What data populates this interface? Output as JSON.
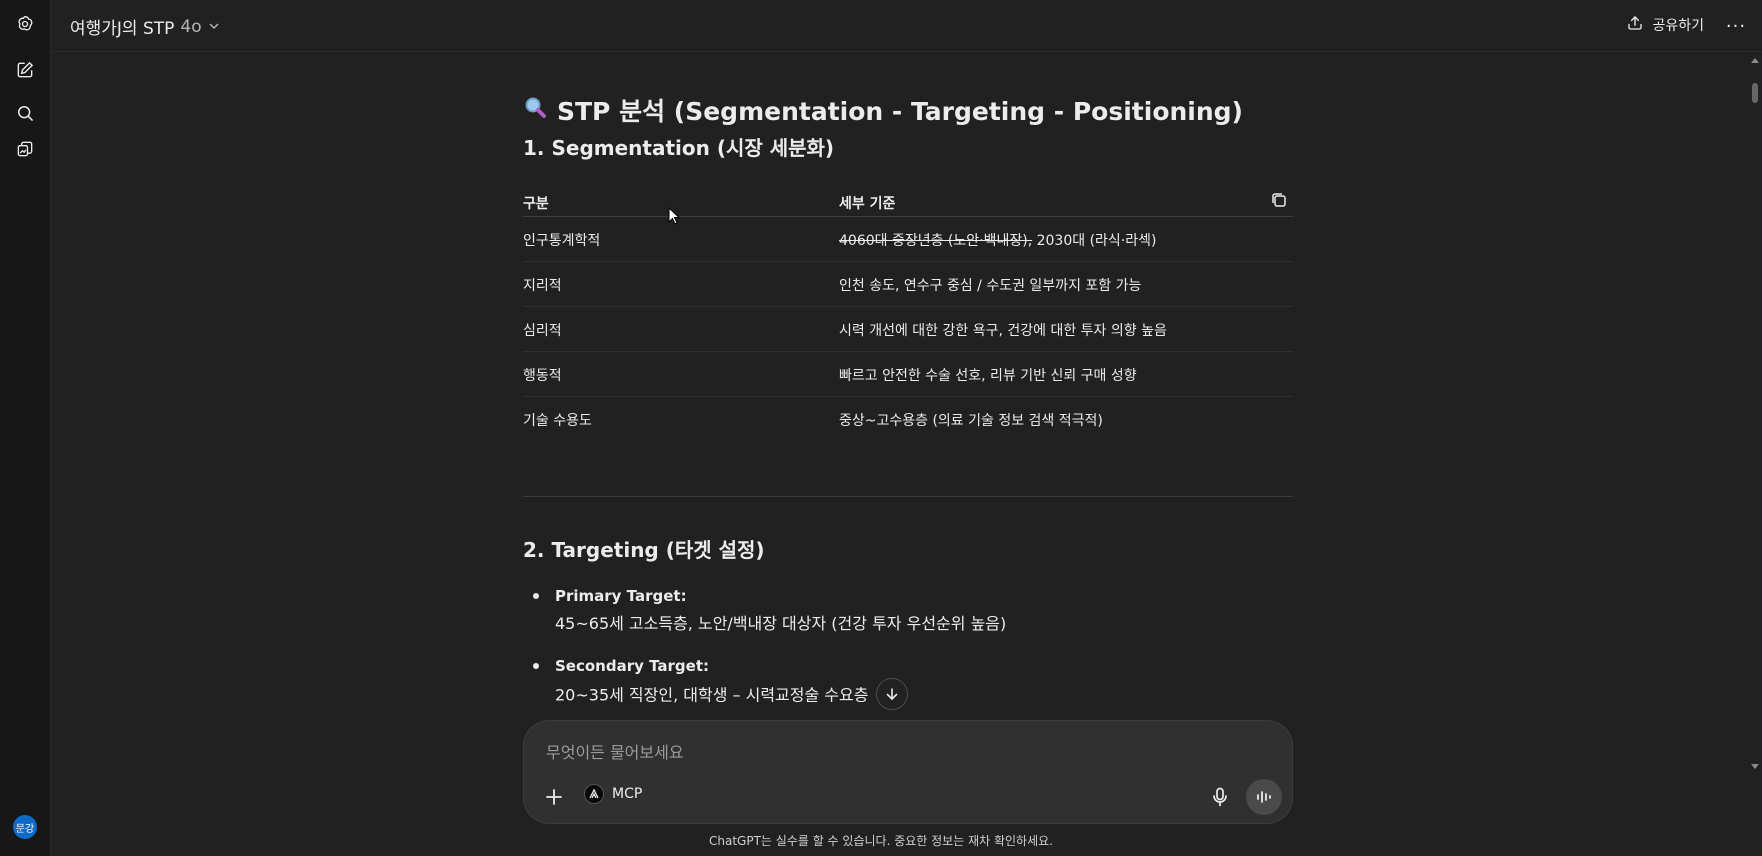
{
  "header": {
    "title": "여행가J의 STP",
    "model": "4o",
    "share_label": "공유하기",
    "more_label": "···"
  },
  "sidebar": {
    "items": [
      {
        "icon": "chatgpt-logo-icon"
      },
      {
        "icon": "new-chat-icon"
      },
      {
        "icon": "search-icon"
      },
      {
        "icon": "library-icon"
      }
    ],
    "avatar_text": "문강"
  },
  "content": {
    "title": "STP 분석 (Segmentation - Targeting - Positioning)",
    "title_icon": "magnifier-icon",
    "section1": "1. Segmentation (시장 세분화)",
    "table": {
      "headers": [
        "구분",
        "세부 기준"
      ],
      "rows": [
        {
          "c1": "인구통계학적",
          "c2_strike": "4060대 중장년층 (노안·백내장),",
          "c2": " 2030대 (라식·라섹)"
        },
        {
          "c1": "지리적",
          "c2_strike": "",
          "c2": "인천 송도, 연수구 중심 / 수도권 일부까지 포함 가능"
        },
        {
          "c1": "심리적",
          "c2_strike": "",
          "c2": "시력 개선에 대한 강한 욕구, 건강에 대한 투자 의향 높음"
        },
        {
          "c1": "행동적",
          "c2_strike": "",
          "c2": "빠르고 안전한 수술 선호, 리뷰 기반 신뢰 구매 성향"
        },
        {
          "c1": "기술 수용도",
          "c2_strike": "",
          "c2": "중상~고수용층 (의료 기술 정보 검색 적극적)"
        }
      ]
    },
    "section2": "2. Targeting (타겟 설정)",
    "targets": [
      {
        "label": "Primary Target:",
        "desc": "45~65세 고소득층, 노안/백내장 대상자 (건강 투자 우선순위 높음)"
      },
      {
        "label": "Secondary Target:",
        "desc": "20~35세 직장인, 대학생 – 시력교정술 수요층"
      }
    ]
  },
  "composer": {
    "placeholder": "무엇이든 물어보세요",
    "mcp_label": "MCP"
  },
  "footer": {
    "disclaimer": "ChatGPT는 실수를 할 수 있습니다. 중요한 정보는 재차 확인하세요."
  }
}
